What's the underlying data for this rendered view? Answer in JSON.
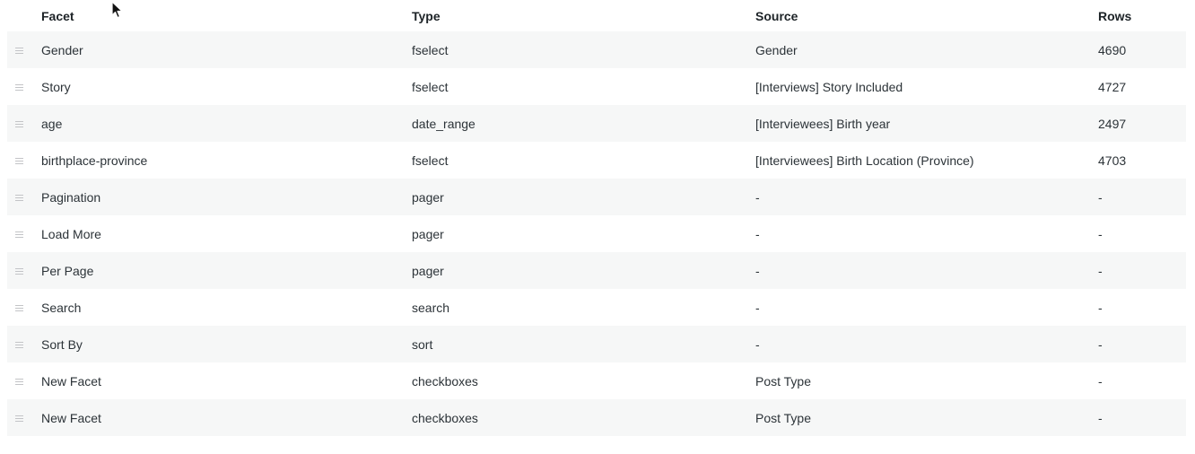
{
  "table": {
    "headers": {
      "facet": "Facet",
      "type": "Type",
      "source": "Source",
      "rows": "Rows"
    },
    "rows": [
      {
        "facet": "Gender",
        "type": "fselect",
        "source": "Gender",
        "rows": "4690"
      },
      {
        "facet": "Story",
        "type": "fselect",
        "source": "[Interviews] Story Included",
        "rows": "4727"
      },
      {
        "facet": "age",
        "type": "date_range",
        "source": "[Interviewees] Birth year",
        "rows": "2497"
      },
      {
        "facet": "birthplace-province",
        "type": "fselect",
        "source": "[Interviewees] Birth Location (Province)",
        "rows": "4703"
      },
      {
        "facet": "Pagination",
        "type": "pager",
        "source": "-",
        "rows": "-"
      },
      {
        "facet": "Load More",
        "type": "pager",
        "source": "-",
        "rows": "-"
      },
      {
        "facet": "Per Page",
        "type": "pager",
        "source": "-",
        "rows": "-"
      },
      {
        "facet": "Search",
        "type": "search",
        "source": "-",
        "rows": "-"
      },
      {
        "facet": "Sort By",
        "type": "sort",
        "source": "-",
        "rows": "-"
      },
      {
        "facet": "New Facet",
        "type": "checkboxes",
        "source": "Post Type",
        "rows": "-"
      },
      {
        "facet": "New Facet",
        "type": "checkboxes",
        "source": "Post Type",
        "rows": "-"
      }
    ]
  },
  "icons": {
    "drag_handle": "drag-handle-icon",
    "cursor": "mouse-pointer-icon"
  },
  "colors": {
    "row_stripe": "#f6f7f7",
    "text": "#2c3338",
    "header_text": "#1d2327",
    "handle": "#c3c4c7"
  }
}
